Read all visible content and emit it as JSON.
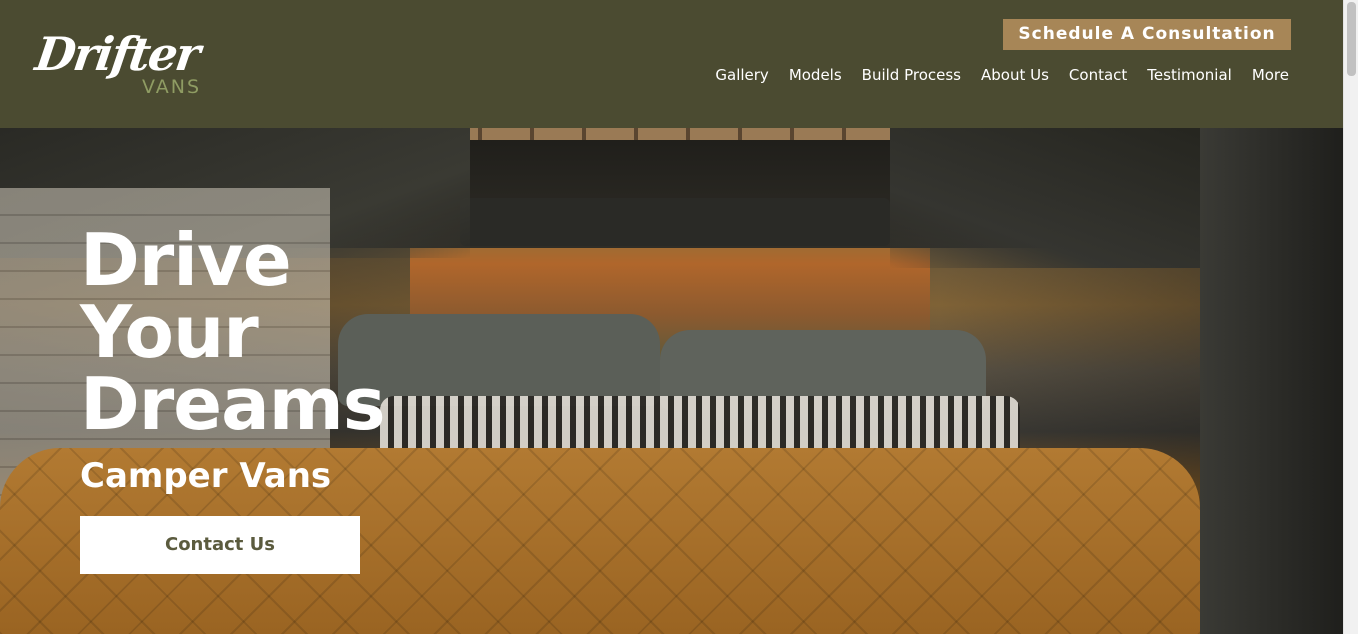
{
  "header": {
    "logo_text": "Drifter",
    "logo_sub": "VANS",
    "cta_label": "Schedule A Consultation",
    "nav": [
      {
        "label": "Gallery"
      },
      {
        "label": "Models"
      },
      {
        "label": "Build Process"
      },
      {
        "label": "About Us"
      },
      {
        "label": "Contact"
      },
      {
        "label": "Testimonial"
      },
      {
        "label": "More"
      }
    ]
  },
  "hero": {
    "title_lines": [
      "Drive",
      "Your",
      "Dreams"
    ],
    "subtitle": "Camper Vans",
    "button_label": "Contact Us",
    "image": "camper-van-interior-photo"
  },
  "colors": {
    "header_bg": "#4b4b31",
    "cta_bg": "#a78657",
    "logo_accent": "#8f9c63",
    "button_text": "#5b5b3e"
  }
}
